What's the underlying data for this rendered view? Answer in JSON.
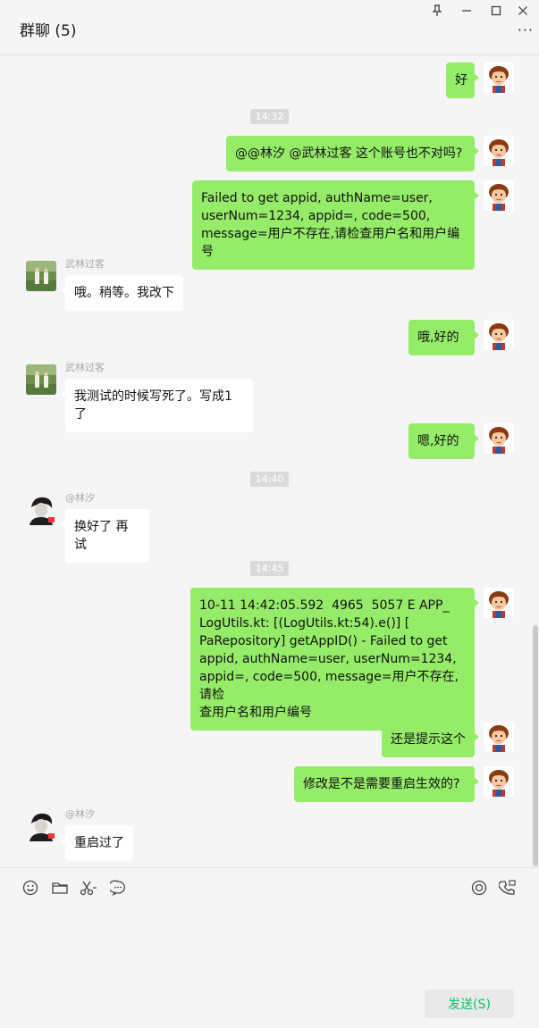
{
  "window": {
    "title": "群聊 (5)",
    "controls": [
      "pin-icon",
      "minimize-icon",
      "maximize-icon",
      "close-icon"
    ],
    "more_label": "···"
  },
  "messages": [
    {
      "kind": "me",
      "text": "好"
    },
    {
      "kind": "time",
      "text": "14:32"
    },
    {
      "kind": "me",
      "text": "@@林汐 @武林过客 这个账号也不对吗?"
    },
    {
      "kind": "me",
      "text": "Failed to get appid, authName=user,\nuserNum=1234, appid=, code=500,\nmessage=用户不存在,请检查用户名和用户编号"
    },
    {
      "kind": "other",
      "sender": "武林过客",
      "text": "哦。稍等。我改下"
    },
    {
      "kind": "me",
      "text": "哦,好的"
    },
    {
      "kind": "other",
      "sender": "武林过客",
      "text": "我测试的时候写死了。写成1了"
    },
    {
      "kind": "me",
      "text": "嗯,好的"
    },
    {
      "kind": "time",
      "text": "14:40"
    },
    {
      "kind": "other",
      "sender": "@林汐",
      "text": "换好了 再试"
    },
    {
      "kind": "time",
      "text": "14:45"
    },
    {
      "kind": "me",
      "text": "10-11 14:42:05.592  4965  5057 E APP_\nLogUtils.kt: [(LogUtils.kt:54).e()] [\nPaRepository] getAppID() - Failed to get\nappid, authName=user, userNum=1234,\nappid=, code=500, message=用户不存在,请检\n查用户名和用户编号"
    },
    {
      "kind": "me",
      "text": "还是提示这个"
    },
    {
      "kind": "me",
      "text": "修改是不是需要重启生效的?"
    },
    {
      "kind": "other",
      "sender": "@林汐",
      "text": "重启过了"
    }
  ],
  "toolbar": {
    "left_icons": [
      "emoji-icon",
      "folder-icon",
      "scissors-icon",
      "chat-history-icon"
    ],
    "right_icons": [
      "live-icon",
      "call-icon"
    ]
  },
  "composer": {
    "send_label": "发送(S)"
  },
  "colors": {
    "my_bubble": "#95ec69",
    "other_bubble": "#ffffff",
    "background": "#f5f5f5",
    "send_text": "#07c160"
  }
}
